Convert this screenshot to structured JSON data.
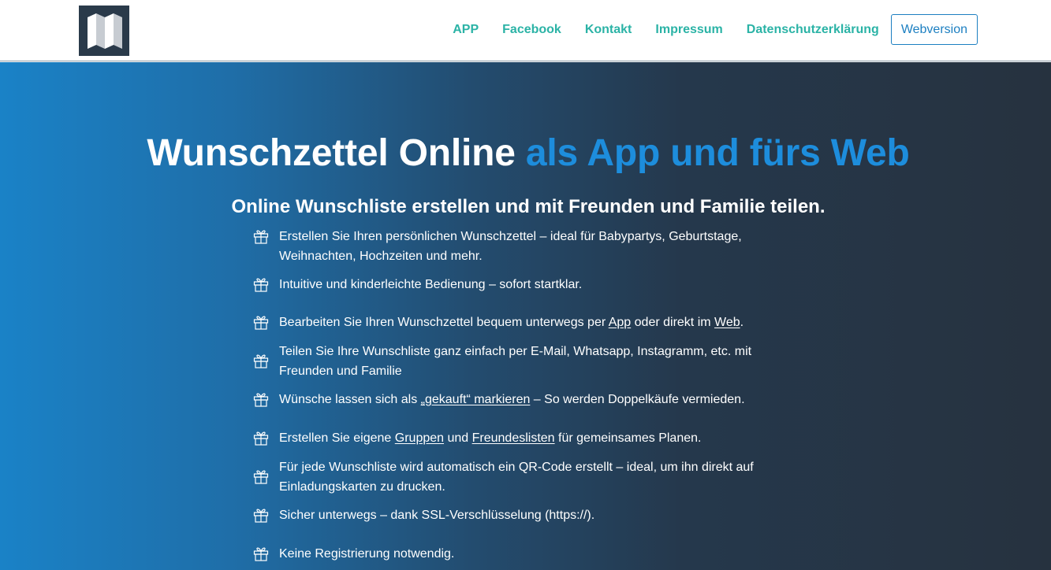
{
  "header": {
    "nav": [
      {
        "label": "APP"
      },
      {
        "label": "Facebook"
      },
      {
        "label": "Kontakt"
      },
      {
        "label": "Impressum"
      },
      {
        "label": "Datenschutzerklärung"
      }
    ],
    "webversion_label": "Webversion"
  },
  "hero": {
    "title_main": "Wunschzettel Online",
    "title_accent": "als App und fürs Web",
    "subtitle": "Online Wunschliste erstellen und mit Freunden und Familie teilen."
  },
  "features": {
    "f0": {
      "line1": "Erstellen Sie Ihren persönlichen Wunschzettel – ideal für Babypartys, Geburtstage,",
      "line2": "Weihnachten, Hochzeiten und mehr."
    },
    "f1": {
      "text": "Intuitive und kinderleichte Bedienung – sofort startklar."
    },
    "f2": {
      "a": "Bearbeiten Sie Ihren Wunschzettel bequem unterwegs per ",
      "link1": "App",
      "b": " oder direkt im ",
      "link2": "Web",
      "c": "."
    },
    "f3": {
      "line1": "Teilen Sie Ihre Wunschliste ganz einfach per E-Mail, Whatsapp, Instagramm, etc. mit",
      "line2": "Freunden und Familie"
    },
    "f4": {
      "a": "Wünsche lassen sich als ",
      "link1": "„gekauft“ markieren",
      "b": " – So werden Doppelkäufe vermieden."
    },
    "f5": {
      "a": "Erstellen Sie eigene ",
      "link1": "Gruppen",
      "b": " und ",
      "link2": "Freundeslisten",
      "c": " für gemeinsames Planen."
    },
    "f6": {
      "line1": "Für jede Wunschliste wird automatisch ein QR-Code erstellt – ideal, um ihn direkt auf",
      "line2": "Einladungskarten zu drucken."
    },
    "f7": {
      "text": "Sicher unterwegs – dank SSL-Verschlüsselung (https://)."
    },
    "f8": {
      "text": "Keine Registrierung notwendig."
    }
  },
  "icons": {
    "logo": "folded-map-icon",
    "bullet": "gift-icon"
  },
  "colors": {
    "nav_link": "#2bb3a6",
    "accent": "#1d8ddc",
    "button_border": "#1c7fc1"
  }
}
